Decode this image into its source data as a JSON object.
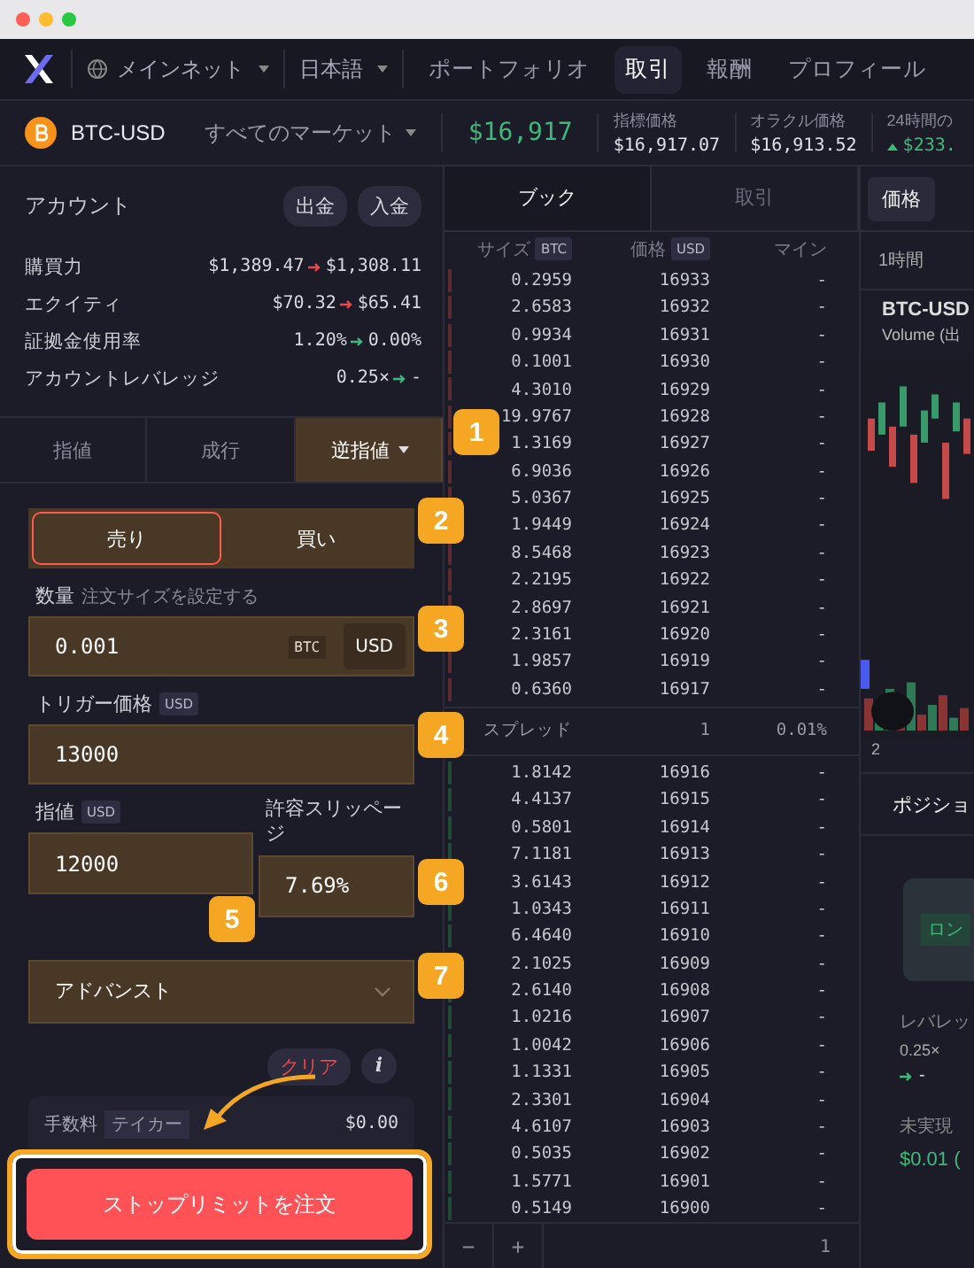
{
  "nav": {
    "network": "メインネット",
    "language": "日本語",
    "links": [
      {
        "label": "ポートフォリオ",
        "selected": false
      },
      {
        "label": "取引",
        "selected": true
      },
      {
        "label": "報酬",
        "selected": false
      },
      {
        "label": "プロフィール",
        "selected": false
      }
    ]
  },
  "market": {
    "symbol": "BTC-USD",
    "all_markets": "すべてのマーケット",
    "price": "$16,917",
    "stats": [
      {
        "label": "指標価格",
        "value": "$16,917.07",
        "rising": false
      },
      {
        "label": "オラクル価格",
        "value": "$16,913.52",
        "rising": false
      },
      {
        "label": "24時間の",
        "value": "$233.",
        "rising": true
      }
    ]
  },
  "account": {
    "title": "アカウント",
    "buttons": [
      "出金",
      "入金"
    ],
    "rows": [
      {
        "label": "購買力",
        "from": "$1,389.47",
        "to": "$1,308.11",
        "color": "#e5484d"
      },
      {
        "label": "エクイティ",
        "from": "$70.32",
        "to": "$65.41",
        "color": "#e5484d"
      },
      {
        "label": "証拠金使用率",
        "from": "1.20%",
        "to": "0.00%",
        "color": "#3fb87a"
      },
      {
        "label": "アカウントレバレッジ",
        "from": "0.25×",
        "to": "-",
        "color": "#3fb87a"
      }
    ]
  },
  "order_form": {
    "tabs": [
      {
        "label": "指値",
        "selected": false,
        "highlighted": false,
        "dropdown": false
      },
      {
        "label": "成行",
        "selected": false,
        "highlighted": false,
        "dropdown": false
      },
      {
        "label": "逆指値",
        "selected": true,
        "highlighted": true,
        "dropdown": true
      }
    ],
    "sides": [
      {
        "label": "売り",
        "selected": true
      },
      {
        "label": "買い",
        "selected": false
      }
    ],
    "sides_highlighted": true,
    "size": {
      "label": "数量",
      "hint": "注文サイズを設定する",
      "value": "0.001",
      "unit": "BTC",
      "toggle": "USD",
      "highlighted": true
    },
    "trigger": {
      "label": "トリガー価格",
      "unit": "USD",
      "value": "13000",
      "highlighted": true
    },
    "limit": {
      "label": "指値",
      "unit": "USD",
      "value": "12000",
      "highlighted": true
    },
    "slippage": {
      "label": "許容スリッページ",
      "value": "7.69%",
      "highlighted": true
    },
    "advanced": {
      "label": "アドバンスト",
      "expanded": false,
      "highlighted": true
    },
    "clear": "クリア",
    "info": "i",
    "fees": [
      {
        "label": "手数料",
        "tag": "テイカー",
        "value": "$0.00"
      }
    ],
    "submit": {
      "label": "ストップリミットを注文",
      "framed": true
    }
  },
  "order_book": {
    "tabs": [
      {
        "label": "ブック",
        "selected": true
      },
      {
        "label": "取引",
        "selected": false
      }
    ],
    "columns": [
      {
        "label": "サイズ",
        "unit": "BTC"
      },
      {
        "label": "価格",
        "unit": "USD"
      },
      {
        "label": "マイン"
      }
    ],
    "asks": [
      {
        "size": "0.2959",
        "price": "16933",
        "mine": "-"
      },
      {
        "size": "2.6583",
        "price": "16932",
        "mine": "-"
      },
      {
        "size": "0.9934",
        "price": "16931",
        "mine": "-"
      },
      {
        "size": "0.1001",
        "price": "16930",
        "mine": "-"
      },
      {
        "size": "4.3010",
        "price": "16929",
        "mine": "-"
      },
      {
        "size": "19.9767",
        "price": "16928",
        "mine": "-"
      },
      {
        "size": "1.3169",
        "price": "16927",
        "mine": "-"
      },
      {
        "size": "6.9036",
        "price": "16926",
        "mine": "-"
      },
      {
        "size": "5.0367",
        "price": "16925",
        "mine": "-"
      },
      {
        "size": "1.9449",
        "price": "16924",
        "mine": "-"
      },
      {
        "size": "8.5468",
        "price": "16923",
        "mine": "-"
      },
      {
        "size": "2.2195",
        "price": "16922",
        "mine": "-"
      },
      {
        "size": "2.8697",
        "price": "16921",
        "mine": "-"
      },
      {
        "size": "2.3161",
        "price": "16920",
        "mine": "-"
      },
      {
        "size": "1.9857",
        "price": "16919",
        "mine": "-"
      },
      {
        "size": "0.6360",
        "price": "16917",
        "mine": "-"
      }
    ],
    "spread": {
      "label": "スプレッド",
      "value": "1",
      "percent": "0.01%"
    },
    "bids": [
      {
        "size": "1.8142",
        "price": "16916",
        "mine": "-"
      },
      {
        "size": "4.4137",
        "price": "16915",
        "mine": "-"
      },
      {
        "size": "0.5801",
        "price": "16914",
        "mine": "-"
      },
      {
        "size": "7.1181",
        "price": "16913",
        "mine": "-"
      },
      {
        "size": "3.6143",
        "price": "16912",
        "mine": "-"
      },
      {
        "size": "1.0343",
        "price": "16911",
        "mine": "-"
      },
      {
        "size": "6.4640",
        "price": "16910",
        "mine": "-"
      },
      {
        "size": "2.1025",
        "price": "16909",
        "mine": "-"
      },
      {
        "size": "2.6140",
        "price": "16908",
        "mine": "-"
      },
      {
        "size": "1.0216",
        "price": "16907",
        "mine": "-"
      },
      {
        "size": "1.0042",
        "price": "16906",
        "mine": "-"
      },
      {
        "size": "1.1331",
        "price": "16905",
        "mine": "-"
      },
      {
        "size": "2.3301",
        "price": "16904",
        "mine": "-"
      },
      {
        "size": "4.6107",
        "price": "16903",
        "mine": "-"
      },
      {
        "size": "0.5035",
        "price": "16902",
        "mine": "-"
      },
      {
        "size": "1.5771",
        "price": "16901",
        "mine": "-"
      },
      {
        "size": "0.5149",
        "price": "16900",
        "mine": "-"
      }
    ],
    "footer": {
      "minus": "−",
      "plus": "+",
      "grouping": "1"
    }
  },
  "right_panel": {
    "tabs": [
      {
        "label": "価格",
        "selected": true
      }
    ],
    "interval": "1時間",
    "symbol": "BTC-USD",
    "volume": "Volume (出",
    "axis_label": "2",
    "position_tab": "ポジショ",
    "position": {
      "side": "ロン",
      "leverage_label": "レバレッ",
      "leverage": "0.25×",
      "leverage_to": "-",
      "pnl_label": "未実現",
      "pnl": "$0.01 ("
    }
  },
  "annotations": [
    {
      "label": "1"
    },
    {
      "label": "2"
    },
    {
      "label": "3"
    },
    {
      "label": "4"
    },
    {
      "label": "5"
    },
    {
      "label": "6"
    },
    {
      "label": "7"
    }
  ]
}
